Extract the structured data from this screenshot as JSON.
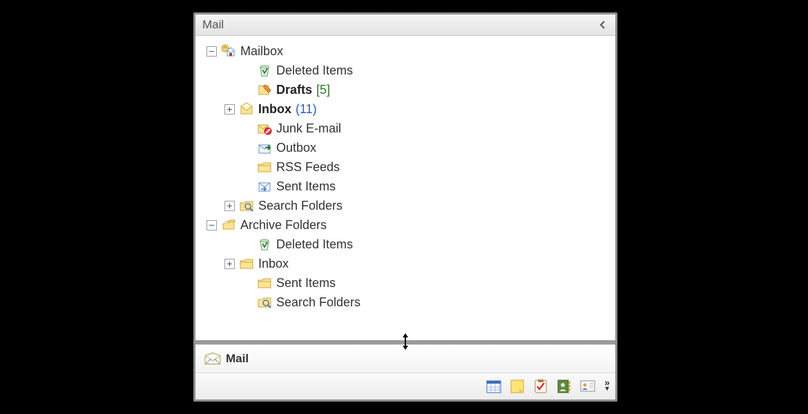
{
  "header": {
    "title": "Mail"
  },
  "tree": {
    "groups": [
      {
        "label": "Mailbox",
        "toggle": "minus",
        "icon": "mailbox-icon",
        "indent": 0,
        "children": [
          {
            "label": "Deleted Items",
            "icon": "trash-icon",
            "toggle": null,
            "bold": false,
            "count": null,
            "countStyle": null,
            "indent": 2
          },
          {
            "label": "Drafts",
            "icon": "drafts-icon",
            "toggle": null,
            "bold": true,
            "count": "[5]",
            "countStyle": "green",
            "indent": 2
          },
          {
            "label": "Inbox",
            "icon": "inbox-icon",
            "toggle": "plus",
            "bold": true,
            "count": "(11)",
            "countStyle": "blue",
            "indent": 1
          },
          {
            "label": "Junk E-mail",
            "icon": "junk-icon",
            "toggle": null,
            "bold": false,
            "count": null,
            "countStyle": null,
            "indent": 2
          },
          {
            "label": "Outbox",
            "icon": "outbox-icon",
            "toggle": null,
            "bold": false,
            "count": null,
            "countStyle": null,
            "indent": 2
          },
          {
            "label": "RSS Feeds",
            "icon": "folder-icon",
            "toggle": null,
            "bold": false,
            "count": null,
            "countStyle": null,
            "indent": 2
          },
          {
            "label": "Sent Items",
            "icon": "sent-icon",
            "toggle": null,
            "bold": false,
            "count": null,
            "countStyle": null,
            "indent": 2
          },
          {
            "label": "Search Folders",
            "icon": "searchfolder-icon",
            "toggle": "plus",
            "bold": false,
            "count": null,
            "countStyle": null,
            "indent": 1
          }
        ]
      },
      {
        "label": "Archive Folders",
        "toggle": "minus",
        "icon": "archive-icon",
        "indent": 0,
        "children": [
          {
            "label": "Deleted Items",
            "icon": "trash-icon",
            "toggle": null,
            "bold": false,
            "count": null,
            "countStyle": null,
            "indent": 2
          },
          {
            "label": "Inbox",
            "icon": "folder-icon",
            "toggle": "plus",
            "bold": false,
            "count": null,
            "countStyle": null,
            "indent": 1
          },
          {
            "label": "Sent Items",
            "icon": "folder-icon",
            "toggle": null,
            "bold": false,
            "count": null,
            "countStyle": null,
            "indent": 2
          },
          {
            "label": "Search Folders",
            "icon": "searchfolder-icon",
            "toggle": null,
            "bold": false,
            "count": null,
            "countStyle": null,
            "indent": 2
          }
        ]
      }
    ]
  },
  "navButton": {
    "label": "Mail",
    "icon": "envelope-icon"
  },
  "toolbar": {
    "buttons": [
      "calendar-icon",
      "notes-icon",
      "tasks-icon",
      "contacts-icon",
      "addressbook-icon"
    ]
  }
}
